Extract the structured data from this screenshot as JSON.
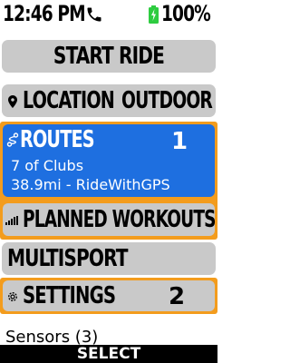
{
  "status_bar": {
    "time": "12:46 PM",
    "battery_percent": "100%",
    "battery_color": "#2ecc40",
    "icons": [
      "phone-icon",
      "battery-icon"
    ]
  },
  "menu": {
    "start_ride": "START RIDE",
    "location": {
      "label": "LOCATION",
      "value": "OUTDOOR",
      "icon": "location-pin-icon"
    },
    "routes": {
      "label": "ROUTES",
      "badge": "1",
      "line1": "7 of Clubs",
      "line2": "38.9mi - RideWithGPS",
      "icon": "route-icon"
    },
    "planned_workouts": {
      "label": "PLANNED WORKOUTS",
      "icon": "bar-chart-icon"
    },
    "multisport": {
      "label": "MULTISPORT"
    },
    "settings": {
      "label": "SETTINGS",
      "badge": "2",
      "icon": "gear-icon"
    },
    "sensors": "Sensors (3)"
  },
  "footer": {
    "select_label": "SELECT"
  },
  "colors": {
    "highlight_frame": "#f39c1d",
    "selected_card": "#1e6fe0",
    "item_background": "#c9c9c9"
  }
}
